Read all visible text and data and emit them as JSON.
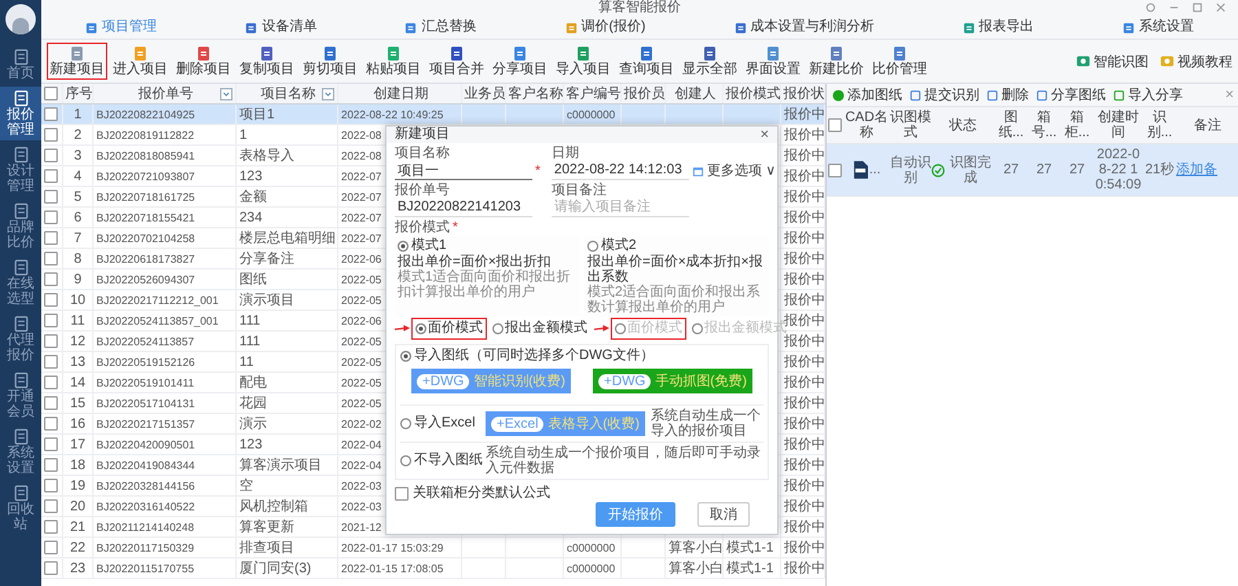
{
  "app_title": "算客智能报价",
  "sidebar": [
    {
      "label": "首页",
      "selected": false
    },
    {
      "label": "报价管理",
      "selected": true
    },
    {
      "label": "设计管理",
      "selected": false
    },
    {
      "label": "品牌比价",
      "selected": false
    },
    {
      "label": "在线选型",
      "selected": false
    },
    {
      "label": "代理报价",
      "selected": false
    },
    {
      "label": "开通会员",
      "selected": false
    },
    {
      "label": "系统设置",
      "selected": false
    },
    {
      "label": "回收站",
      "selected": false
    }
  ],
  "nav_tabs": [
    {
      "label": "项目管理",
      "selected": true
    },
    {
      "label": "设备清单",
      "selected": false
    },
    {
      "label": "汇总替换",
      "selected": false
    },
    {
      "label": "调价(报价)",
      "selected": false
    },
    {
      "label": "成本设置与利润分析",
      "selected": false
    },
    {
      "label": "报表导出",
      "selected": false
    },
    {
      "label": "系统设置",
      "selected": false
    }
  ],
  "toolbar": [
    {
      "label": "新建项目",
      "highlighted": true
    },
    {
      "label": "进入项目",
      "highlighted": false
    },
    {
      "label": "删除项目",
      "highlighted": false
    },
    {
      "label": "复制项目",
      "highlighted": false
    },
    {
      "label": "剪切项目",
      "highlighted": false
    },
    {
      "label": "粘贴项目",
      "highlighted": false
    },
    {
      "label": "项目合并",
      "highlighted": false
    },
    {
      "label": "分享项目",
      "highlighted": false
    },
    {
      "label": "导入项目",
      "highlighted": false
    },
    {
      "label": "查询项目",
      "highlighted": false
    },
    {
      "label": "显示全部",
      "highlighted": false
    },
    {
      "label": "界面设置",
      "highlighted": false
    },
    {
      "label": "新建比价",
      "highlighted": false
    },
    {
      "label": "比价管理",
      "highlighted": false
    }
  ],
  "toolbar_right": [
    "智能识图",
    "视频教程"
  ],
  "table": {
    "select_all_checked": false,
    "columns": [
      {
        "label": "序号",
        "filter": false
      },
      {
        "label": "报价单号",
        "filter": true
      },
      {
        "label": "项目名称",
        "filter": true
      },
      {
        "label": "创建日期",
        "filter": false
      },
      {
        "label": "业务员",
        "filter": false
      },
      {
        "label": "客户名称",
        "filter": false
      },
      {
        "label": "客户编号",
        "filter": false
      },
      {
        "label": "报价员",
        "filter": false
      },
      {
        "label": "创建人",
        "filter": false
      },
      {
        "label": "报价模式",
        "filter": false
      },
      {
        "label": "报价状",
        "filter": false
      }
    ],
    "rows": [
      {
        "selected": true,
        "checked": false,
        "seq": "1",
        "number": "BJ20220822104925",
        "name": "项目1",
        "date": "2022-08-22 10:49:25",
        "customer_no": "c0000000",
        "status": "报价中"
      },
      {
        "selected": false,
        "checked": false,
        "seq": "2",
        "number": "BJ20220819112822",
        "name": "1",
        "date": "2022-08",
        "status": "报价中"
      },
      {
        "selected": false,
        "checked": false,
        "seq": "3",
        "number": "BJ20220818085941",
        "name": "表格导入",
        "date": "2022-08",
        "status": "报价中"
      },
      {
        "selected": false,
        "checked": false,
        "seq": "4",
        "number": "BJ20220721093807",
        "name": "123",
        "date": "2022-07",
        "status": "报价中"
      },
      {
        "selected": false,
        "checked": false,
        "seq": "5",
        "number": "BJ20220718161725",
        "name": "金额",
        "date": "2022-07",
        "status": "报价中"
      },
      {
        "selected": false,
        "checked": false,
        "seq": "6",
        "number": "BJ20220718155421",
        "name": "234",
        "date": "2022-07",
        "status": "报价中"
      },
      {
        "selected": false,
        "checked": false,
        "seq": "7",
        "number": "BJ20220702104258",
        "name": "楼层总电箱明细",
        "date": "2022-07",
        "status": "报价中"
      },
      {
        "selected": false,
        "checked": false,
        "seq": "8",
        "number": "BJ20220618173827",
        "name": "分享备注",
        "date": "2022-06",
        "status": "报价中"
      },
      {
        "selected": false,
        "checked": false,
        "seq": "9",
        "number": "BJ20220526094307",
        "name": "图纸",
        "date": "2022-05",
        "status": "报价中"
      },
      {
        "selected": false,
        "checked": false,
        "seq": "10",
        "number": "BJ20220217112212_001",
        "name": "演示项目",
        "date": "2022-05",
        "status": "报价中"
      },
      {
        "selected": false,
        "checked": false,
        "seq": "11",
        "number": "BJ20220524113857_001",
        "name": "111",
        "date": "2022-06",
        "status": "报价中"
      },
      {
        "selected": false,
        "checked": false,
        "seq": "12",
        "number": "BJ20220524113857",
        "name": "111",
        "date": "2022-05",
        "status": "报价中"
      },
      {
        "selected": false,
        "checked": false,
        "seq": "13",
        "number": "BJ20220519152126",
        "name": "11",
        "date": "2022-05",
        "status": "报价中"
      },
      {
        "selected": false,
        "checked": false,
        "seq": "14",
        "number": "BJ20220519101411",
        "name": "配电",
        "date": "2022-05",
        "status": "报价中"
      },
      {
        "selected": false,
        "checked": false,
        "seq": "15",
        "number": "BJ20220517104131",
        "name": "花园",
        "date": "2022-05",
        "status": "报价中"
      },
      {
        "selected": false,
        "checked": false,
        "seq": "16",
        "number": "BJ20220217151357",
        "name": "演示",
        "date": "2022-02",
        "status": "报价中"
      },
      {
        "selected": false,
        "checked": false,
        "seq": "17",
        "number": "BJ20220420090501",
        "name": "123",
        "date": "2022-04",
        "status": "报价中"
      },
      {
        "selected": false,
        "checked": false,
        "seq": "18",
        "number": "BJ20220419084344",
        "name": "算客演示项目",
        "date": "2022-04",
        "status": "报价中"
      },
      {
        "selected": false,
        "checked": false,
        "seq": "19",
        "number": "BJ20220328144156",
        "name": "空",
        "date": "2022-03",
        "status": "报价中"
      },
      {
        "selected": false,
        "checked": false,
        "seq": "20",
        "number": "BJ20220316140522",
        "name": "风机控制箱",
        "date": "2022-03",
        "status": "报价中"
      },
      {
        "selected": false,
        "checked": false,
        "seq": "21",
        "number": "BJ20211214140248",
        "name": "算客更新",
        "date": "2021-12",
        "status": "报价中"
      },
      {
        "selected": false,
        "checked": false,
        "seq": "22",
        "number": "BJ20220117150329",
        "name": "排查项目",
        "date": "2022-01-17 15:03:29",
        "customer_no": "c0000000",
        "creator": "算客小白",
        "mode": "模式1-1",
        "status": "报价中"
      },
      {
        "selected": false,
        "checked": false,
        "seq": "23",
        "number": "BJ20220115170755",
        "name": "厦门同安(3)",
        "date": "2022-01-15 17:08:05",
        "customer_no": "c0000000",
        "creator": "算客小白",
        "mode": "模式1-1",
        "status": "报价中"
      }
    ]
  },
  "dialog": {
    "title": "新建项目",
    "close": "×",
    "fields": [
      {
        "label": "项目名称",
        "value": "项目一",
        "required": true
      },
      {
        "label": "日期",
        "value": "2022-08-22 14:12:03",
        "required": false
      },
      {
        "label": "报价单号",
        "value": "BJ20220822141203",
        "required": false
      },
      {
        "label": "项目备注",
        "placeholder": "请输入项目备注",
        "required": false
      }
    ],
    "more_options": "更多选项 ∨",
    "required_mark": "*",
    "mode_label": "报价模式",
    "mode_required": true,
    "modes": [
      {
        "label": "模式1",
        "selected": true,
        "formula": "报出单价=面价×报出折扣",
        "description": "模式1适合面向面价和报出折扣计算报出单价的用户",
        "options": [
          {
            "label": "面价模式",
            "selected": true,
            "disabled": false,
            "highlighted": true
          },
          {
            "label": "报出金额模式",
            "selected": false,
            "disabled": false,
            "highlighted": false
          }
        ]
      },
      {
        "label": "模式2",
        "selected": false,
        "formula": "报出单价=面价×成本折扣×报出系数",
        "description": "模式2适合面向面价和报出系数计算报出单价的用户",
        "options": [
          {
            "label": "面价模式",
            "selected": false,
            "disabled": true,
            "highlighted": true
          },
          {
            "label": "报出金额模式",
            "selected": false,
            "disabled": true,
            "highlighted": false
          }
        ]
      }
    ],
    "imports": [
      {
        "kind": "dwg",
        "label": "导入图纸",
        "hint": "（可同时选择多个DWG文件）",
        "selected": true,
        "buttons": [
          {
            "tag": "+DWG",
            "label": "智能识别(收费)",
            "color": "#5b9bf5"
          },
          {
            "tag": "+DWG",
            "label": "手动抓图(免费)",
            "color": "#1aa61a"
          }
        ]
      },
      {
        "kind": "excel",
        "label": "导入Excel",
        "selected": false,
        "buttons": [
          {
            "tag": "+Excel",
            "label": "表格导入(收费)",
            "color": "#5b9bf5"
          }
        ],
        "note": "系统自动生成一个导入的报价项目"
      },
      {
        "kind": "none",
        "label": "不导入图纸",
        "selected": false,
        "note": "系统自动生成一个报价项目，随后即可手动录入元件数据"
      }
    ],
    "checkbox": {
      "label": "关联箱柜分类默认公式",
      "checked": false
    },
    "buttons": [
      {
        "label": "开始报价",
        "primary": true
      },
      {
        "label": "取消",
        "primary": false
      }
    ]
  },
  "drawing_panel": {
    "select_all_checked": false,
    "toolbar": [
      "添加图纸",
      "提交识别",
      "删除",
      "分享图纸",
      "导入分享"
    ],
    "close": "×",
    "columns": [
      "CAD名称",
      "识图模式",
      "状态",
      "图纸...",
      "箱号...",
      "箱柜...",
      "创建时间",
      "识别...",
      "备注"
    ],
    "rows": [
      {
        "selected": true,
        "checked": false,
        "file": "...",
        "mode": "自动识别",
        "status": "识图完成",
        "drawings": "27",
        "box_no": "27",
        "cabinets": "27",
        "created": "2022-08-22 10:54:09",
        "duration": "21秒",
        "remark": "添加备"
      }
    ]
  }
}
